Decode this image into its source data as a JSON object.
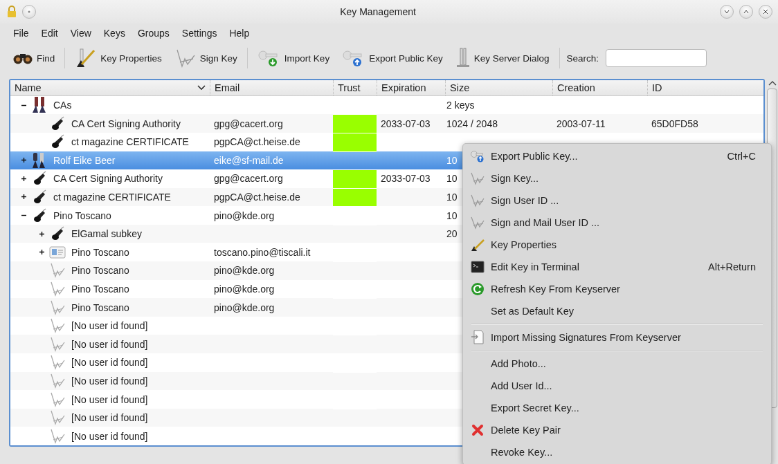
{
  "window": {
    "title": "Key Management"
  },
  "menubar": [
    "File",
    "Edit",
    "View",
    "Keys",
    "Groups",
    "Settings",
    "Help"
  ],
  "toolbar": {
    "groups": [
      [
        {
          "kind": "find",
          "label": "Find"
        }
      ],
      [
        {
          "kind": "properties",
          "label": "Key Properties"
        },
        {
          "kind": "sign",
          "label": "Sign Key"
        }
      ],
      [
        {
          "kind": "import",
          "label": "Import Key"
        },
        {
          "kind": "export",
          "label": "Export Public Key"
        },
        {
          "kind": "server",
          "label": "Key Server Dialog"
        }
      ]
    ],
    "search_label": "Search:"
  },
  "table": {
    "columns": [
      {
        "label": "Name",
        "sorted": true
      },
      {
        "label": "Email",
        "sorted": false
      },
      {
        "label": "Trust",
        "sorted": false
      },
      {
        "label": "Expiration",
        "sorted": false
      },
      {
        "label": "Size",
        "sorted": false
      },
      {
        "label": "Creation",
        "sorted": false
      },
      {
        "label": "ID",
        "sorted": false
      }
    ],
    "rows": [
      {
        "kind": "group",
        "name": "CAs",
        "size": "2 keys",
        "expanded": true,
        "selected": false,
        "children": [
          {
            "kind": "public",
            "name": "CA Cert Signing Authority",
            "email": "gpg@cacert.org",
            "color": "#99ff00",
            "expiration": "2033-07-03",
            "size": "1024 / 2048",
            "creation": "2003-07-11",
            "id": "65D0FD58",
            "selected": false
          },
          {
            "kind": "public",
            "name": "ct magazine CERTIFICATE",
            "email": "pgpCA@ct.heise.de",
            "color": "#99ff00",
            "selected": false
          }
        ]
      },
      {
        "kind": "pair",
        "name": "Rolf Eike Beer",
        "email": "eike@sf-mail.de",
        "size": "10",
        "expanded": false,
        "selected": true
      },
      {
        "kind": "public",
        "name": "CA Cert Signing Authority",
        "email": "gpg@cacert.org",
        "color": "#99ff00",
        "expiration": "2033-07-03",
        "size": "10",
        "expanded": false,
        "selected": false
      },
      {
        "kind": "public",
        "name": "ct magazine CERTIFICATE",
        "email": "pgpCA@ct.heise.de",
        "color": "#99ff00",
        "size": "10",
        "expanded": false,
        "selected": false
      },
      {
        "kind": "public",
        "name": "Pino Toscano",
        "email": "pino@kde.org",
        "size": "10",
        "expanded": true,
        "selected": false,
        "children": [
          {
            "kind": "subkey",
            "name": "ElGamal subkey",
            "size": "20",
            "expanded": false,
            "selected": false
          },
          {
            "kind": "photo",
            "name": "Pino Toscano",
            "email": "toscano.pino@tiscali.it",
            "expanded": false,
            "selected": false
          },
          {
            "kind": "signature",
            "name": "Pino Toscano",
            "email": "pino@kde.org",
            "selected": false
          },
          {
            "kind": "signature",
            "name": "Pino Toscano",
            "email": "pino@kde.org",
            "selected": false
          },
          {
            "kind": "signature",
            "name": "Pino Toscano",
            "email": "pino@kde.org",
            "selected": false
          },
          {
            "kind": "signature",
            "name": "[No user id found]",
            "selected": false
          },
          {
            "kind": "signature",
            "name": "[No user id found]",
            "selected": false
          },
          {
            "kind": "signature",
            "name": "[No user id found]",
            "selected": false
          },
          {
            "kind": "signature",
            "name": "[No user id found]",
            "selected": false
          },
          {
            "kind": "signature",
            "name": "[No user id found]",
            "selected": false
          },
          {
            "kind": "signature",
            "name": "[No user id found]",
            "selected": false
          },
          {
            "kind": "signature",
            "name": "[No user id found]",
            "selected": false
          }
        ]
      }
    ]
  },
  "context_menu": {
    "items": [
      {
        "kind": "export",
        "label": "Export Public Key...",
        "shortcut": "Ctrl+C"
      },
      {
        "kind": "sign",
        "label": "Sign Key..."
      },
      {
        "kind": "sign",
        "label": "Sign User ID ..."
      },
      {
        "kind": "sign",
        "label": "Sign and Mail User ID ..."
      },
      {
        "kind": "properties",
        "label": "Key Properties"
      },
      {
        "kind": "terminal",
        "label": "Edit Key in Terminal",
        "shortcut": "Alt+Return"
      },
      {
        "kind": "refresh",
        "label": "Refresh Key From Keyserver"
      },
      {
        "kind": "plain",
        "label": "Set as Default Key"
      },
      {
        "kind": "separator"
      },
      {
        "kind": "import",
        "label": "Import Missing Signatures From Keyserver"
      },
      {
        "kind": "separator"
      },
      {
        "kind": "plain",
        "label": "Add Photo..."
      },
      {
        "kind": "plain",
        "label": "Add User Id..."
      },
      {
        "kind": "plain",
        "label": "Export Secret Key..."
      },
      {
        "kind": "delete",
        "label": "Delete Key Pair"
      },
      {
        "kind": "plain",
        "label": "Revoke Key..."
      }
    ]
  }
}
